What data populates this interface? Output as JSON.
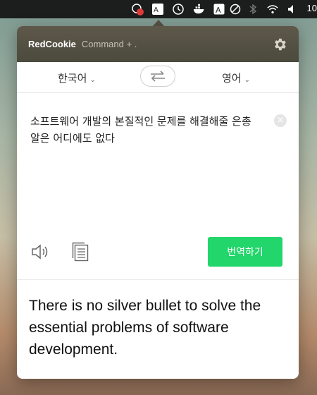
{
  "menubar": {
    "icons": [
      "notification-badge-icon",
      "translate-icon",
      "time-machine-icon",
      "docker-icon",
      "text-input-icon",
      "circle-slash-icon",
      "bluetooth-icon",
      "wifi-icon",
      "volume-icon"
    ],
    "time_partial": "10"
  },
  "app": {
    "brand": "RedCookie",
    "shortcut": "Command + ."
  },
  "languages": {
    "source": "한국어",
    "target": "영어"
  },
  "source_text": "소프트웨어 개발의 본질적인 문제를 해결해줄 은총알은 어디에도 없다",
  "actions": {
    "translate_label": "번역하기"
  },
  "result_text": "There is no silver bullet to solve the essential problems of software development.",
  "colors": {
    "accent": "#22d66b",
    "header": "#56524a"
  }
}
